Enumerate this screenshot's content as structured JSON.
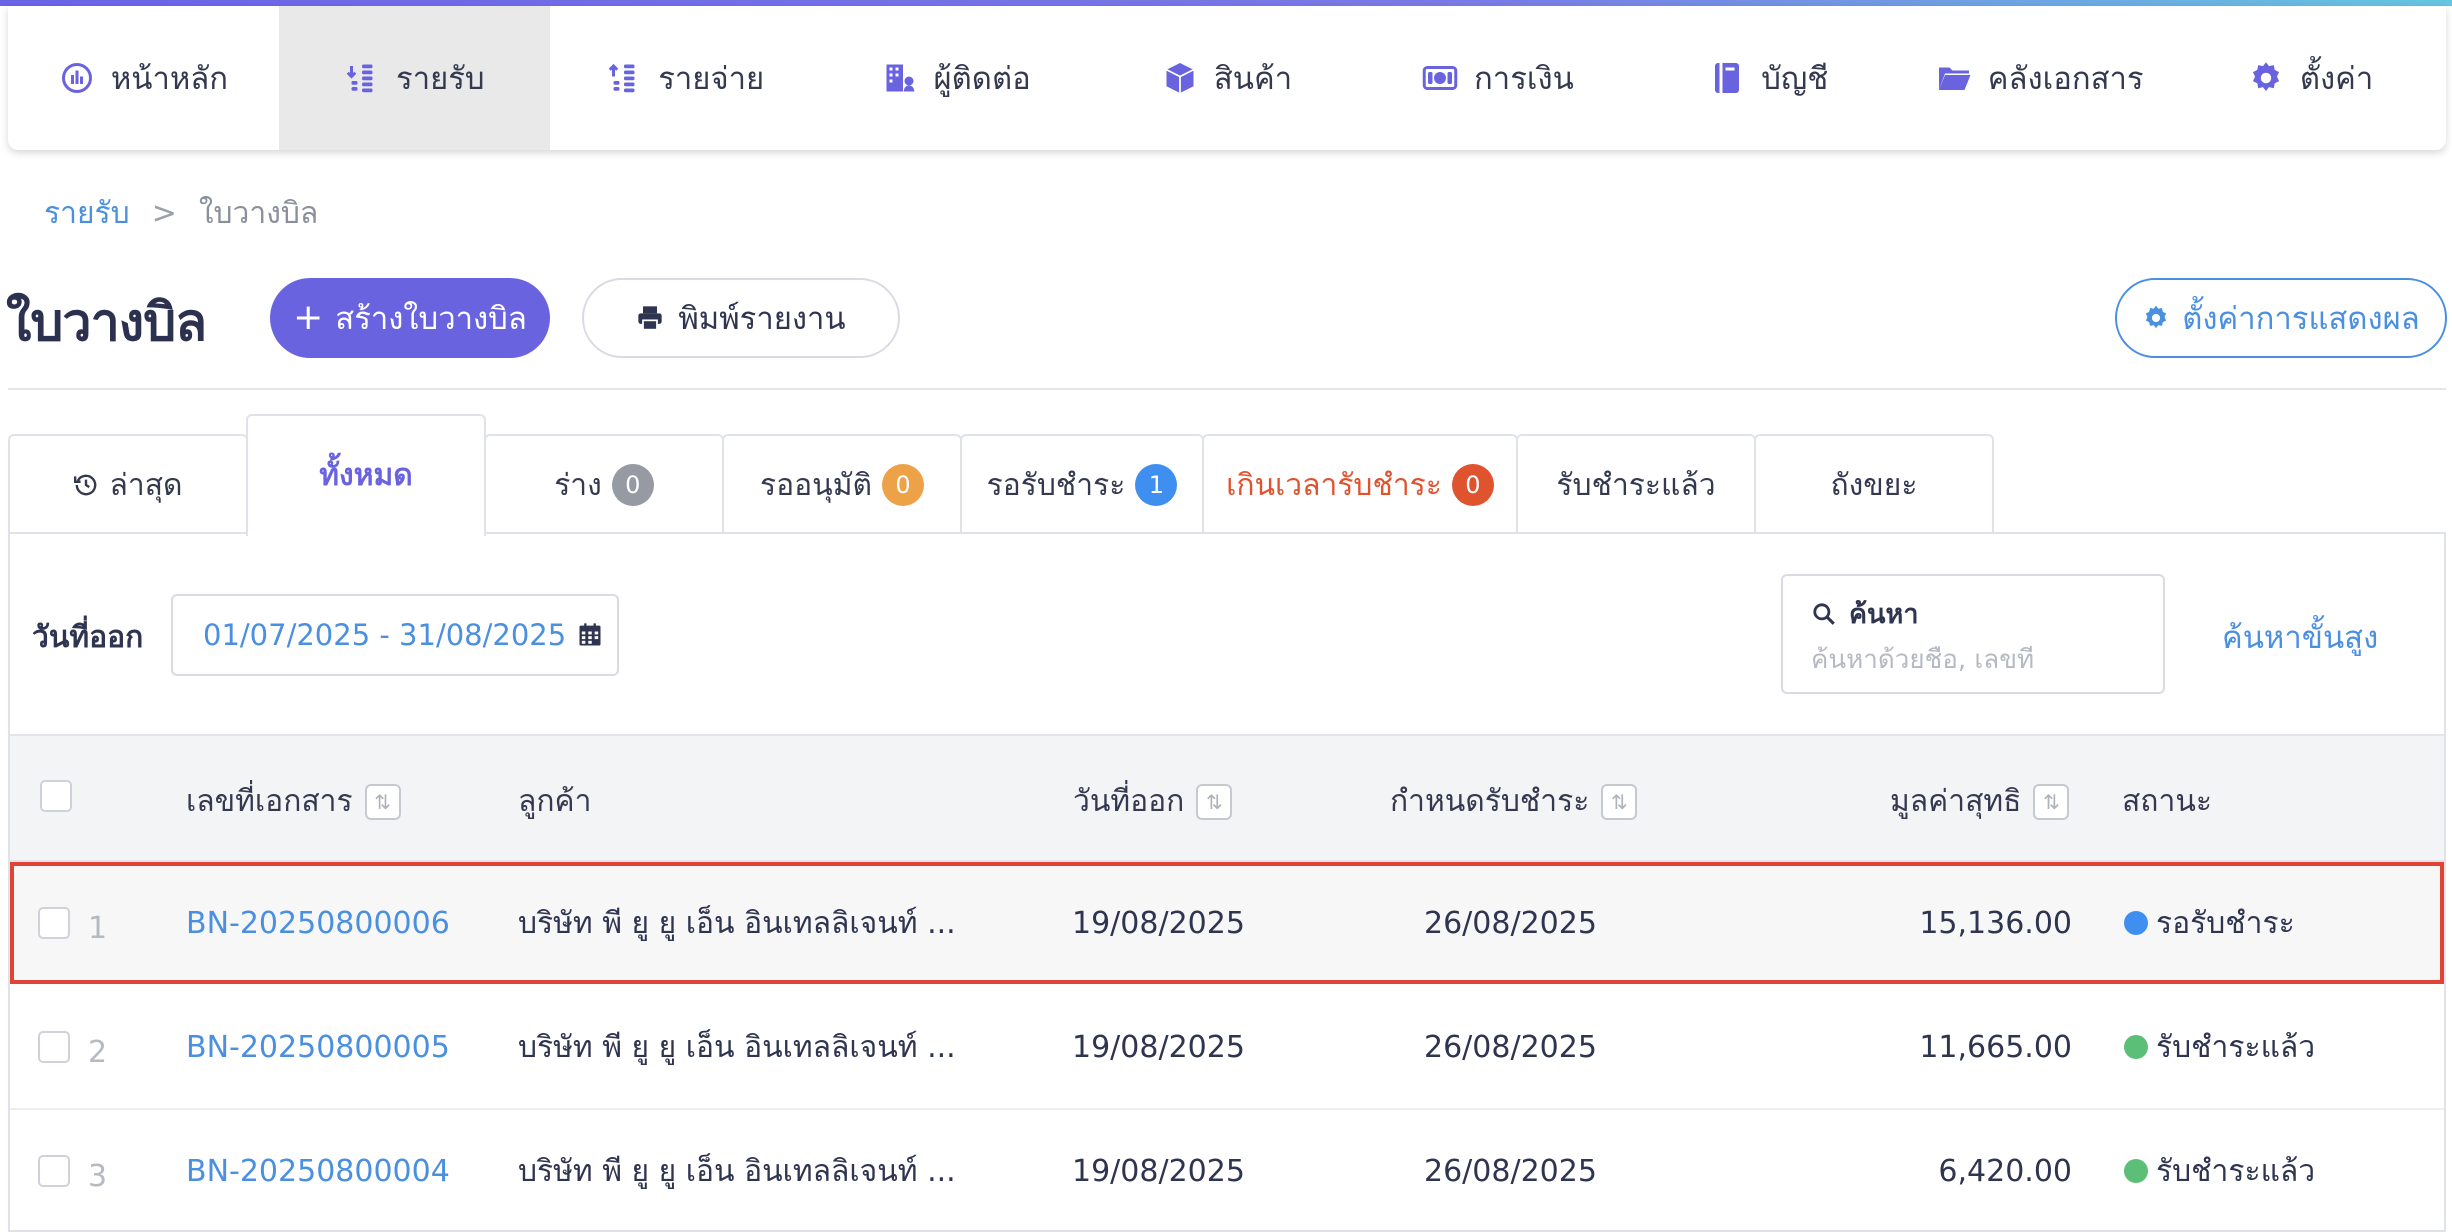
{
  "nav": {
    "items": [
      {
        "label": "หน้าหลัก",
        "icon": "dashboard-icon",
        "active": false
      },
      {
        "label": "รายรับ",
        "icon": "income-coins-icon",
        "active": true
      },
      {
        "label": "รายจ่าย",
        "icon": "expense-coins-icon",
        "active": false
      },
      {
        "label": "ผู้ติดต่อ",
        "icon": "contacts-building-icon",
        "active": false
      },
      {
        "label": "สินค้า",
        "icon": "box-icon",
        "active": false
      },
      {
        "label": "การเงิน",
        "icon": "money-icon",
        "active": false
      },
      {
        "label": "บัญชี",
        "icon": "ledger-book-icon",
        "active": false
      },
      {
        "label": "คลังเอกสาร",
        "icon": "folder-icon",
        "active": false
      },
      {
        "label": "ตั้งค่า",
        "icon": "gear-icon",
        "active": false
      }
    ]
  },
  "breadcrumb": {
    "parent": "รายรับ",
    "separator": ">",
    "current": "ใบวางบิล"
  },
  "header": {
    "title": "ใบวางบิล",
    "create_label": "สร้างใบวางบิล",
    "print_label": "พิมพ์รายงาน",
    "display_settings_label": "ตั้งค่าการแสดงผล"
  },
  "tabs": [
    {
      "label": "ล่าสุด",
      "badge": null
    },
    {
      "label": "ทั้งหมด",
      "badge": null
    },
    {
      "label": "ร่าง",
      "badge": "0"
    },
    {
      "label": "รออนุมัติ",
      "badge": "0"
    },
    {
      "label": "รอรับชำระ",
      "badge": "1"
    },
    {
      "label": "เกินเวลารับชำระ",
      "badge": "0"
    },
    {
      "label": "รับชำระแล้ว",
      "badge": null
    },
    {
      "label": "ถังขยะ",
      "badge": null
    }
  ],
  "filter": {
    "date_label": "วันที่ออก",
    "date_range": "01/07/2025 - 31/08/2025",
    "search_label": "ค้นหา",
    "search_placeholder": "ค้นหาด้วยชื่อ, เลขที่",
    "advanced_search_label": "ค้นหาขั้นสูง"
  },
  "table": {
    "columns": {
      "doc_no": "เลขที่เอกสาร",
      "customer": "ลูกค้า",
      "issue_date": "วันที่ออก",
      "due_date": "กำหนดรับชำระ",
      "net_amount": "มูลค่าสุทธิ",
      "status": "สถานะ"
    },
    "rows": [
      {
        "index": "1",
        "doc_no": "BN-20250800006",
        "customer": "บริษัท พี ยู ยู เอ็น อินเทลลิเจนท์ ...",
        "issue_date": "19/08/2025",
        "due_date": "26/08/2025",
        "net_amount": "15,136.00",
        "status": "รอรับชำระ",
        "status_color": "#3f8ff0"
      },
      {
        "index": "2",
        "doc_no": "BN-20250800005",
        "customer": "บริษัท พี ยู ยู เอ็น อินเทลลิเจนท์ ...",
        "issue_date": "19/08/2025",
        "due_date": "26/08/2025",
        "net_amount": "11,665.00",
        "status": "รับชำระแล้ว",
        "status_color": "#5cbf78"
      },
      {
        "index": "3",
        "doc_no": "BN-20250800004",
        "customer": "บริษัท พี ยู ยู เอ็น อินเทลลิเจนท์ ...",
        "issue_date": "19/08/2025",
        "due_date": "26/08/2025",
        "net_amount": "6,420.00",
        "status": "รับชำระแล้ว",
        "status_color": "#5cbf78"
      }
    ]
  },
  "colors": {
    "accent": "#6a63e0",
    "link": "#4a8fe0",
    "overdue": "#e0532f",
    "highlight_border": "#e04434"
  }
}
